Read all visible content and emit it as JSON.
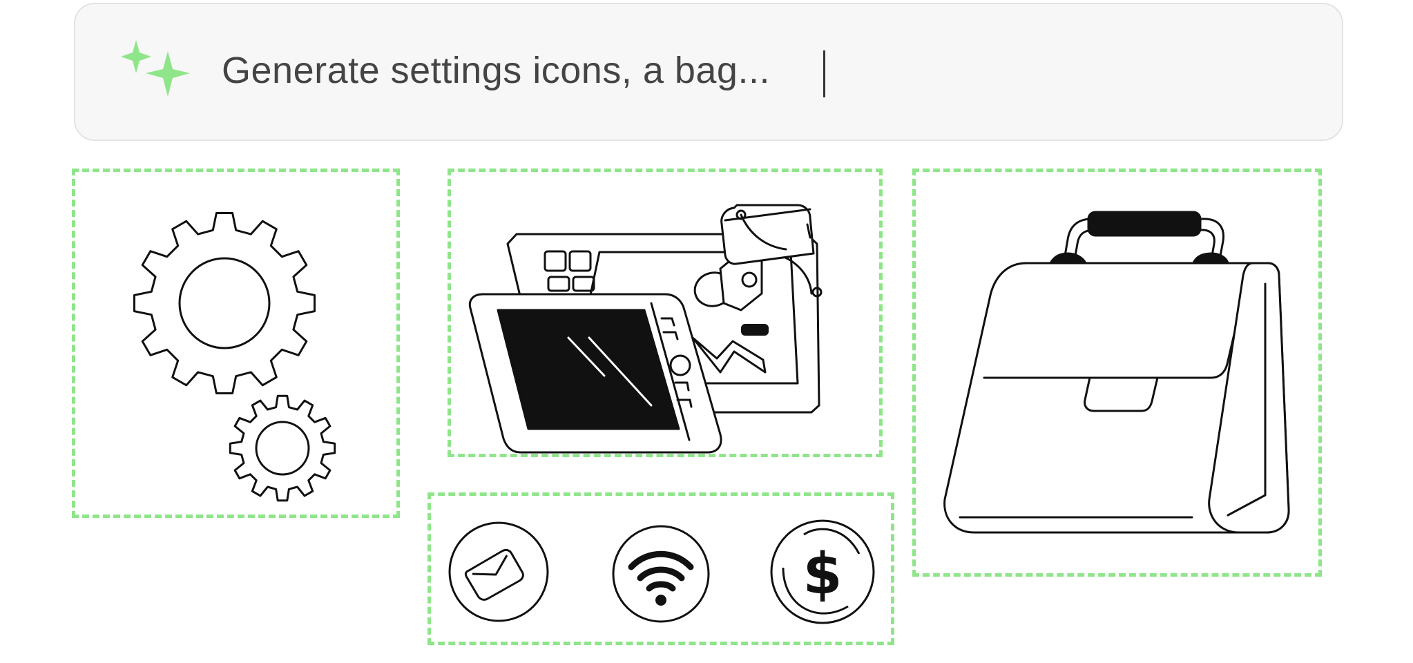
{
  "prompt": {
    "text": "Generate settings icons, a bag... ",
    "icon": "sparkle-icon",
    "accent_color": "#8fe58a"
  },
  "illustrations": [
    {
      "name": "gears",
      "icon": "gears-icon"
    },
    {
      "name": "tablet-design",
      "icon": "tablet-pen-icon"
    },
    {
      "name": "briefcase",
      "icon": "briefcase-icon"
    },
    {
      "name": "circle-icons",
      "icons": [
        "mail-icon",
        "wifi-icon",
        "dollar-icon"
      ]
    }
  ],
  "colors": {
    "frame_border": "#8fe58a",
    "line_art": "#111111",
    "prompt_bg": "#f6f7f6"
  }
}
